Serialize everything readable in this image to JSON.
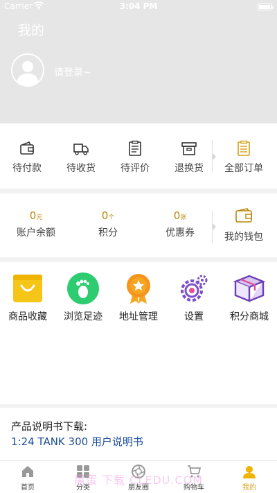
{
  "status_bar": {
    "carrier": "Carrier",
    "time": "3:04 PM"
  },
  "header": {
    "title": "我的",
    "login_prompt": "请登录~"
  },
  "orders": {
    "items": [
      {
        "label": "待付款",
        "icon": "wallet-icon"
      },
      {
        "label": "待收货",
        "icon": "truck-icon"
      },
      {
        "label": "待评价",
        "icon": "clipboard-icon"
      },
      {
        "label": "退换货",
        "icon": "box-icon"
      }
    ],
    "all_orders": {
      "label": "全部订单",
      "icon": "order-list-icon"
    }
  },
  "wallet": {
    "items": [
      {
        "value": "0",
        "unit": "元",
        "label": "账户余额"
      },
      {
        "value": "0",
        "unit": "个",
        "label": "积分"
      },
      {
        "value": "0",
        "unit": "张",
        "label": "优惠券"
      }
    ],
    "my_wallet": {
      "label": "我的钱包",
      "icon": "wallet-icon"
    }
  },
  "tools": [
    {
      "label": "商品收藏",
      "icon": "shopping-bag-icon"
    },
    {
      "label": "浏览足迹",
      "icon": "footprint-icon"
    },
    {
      "label": "地址管理",
      "icon": "medal-icon"
    },
    {
      "label": "设置",
      "icon": "gear-icon"
    },
    {
      "label": "积分商城",
      "icon": "gift-box-icon"
    }
  ],
  "manual": {
    "title": "产品说明书下载:",
    "link": "1:24 TANK 300 用户说明书"
  },
  "tabbar": {
    "tabs": [
      {
        "label": "首页",
        "icon": "home-icon"
      },
      {
        "label": "分类",
        "icon": "grid-icon"
      },
      {
        "label": "朋友圈",
        "icon": "aperture-icon"
      },
      {
        "label": "购物车",
        "icon": "cart-icon"
      },
      {
        "label": "我的",
        "icon": "user-icon",
        "active": true
      }
    ],
    "watermark": "屠蛋 下载 CLEDU.COM"
  },
  "colors": {
    "accent": "#d4a017",
    "number": "#b8860b",
    "link": "#1e4d9a",
    "header_bg": "#e6e6e6"
  }
}
